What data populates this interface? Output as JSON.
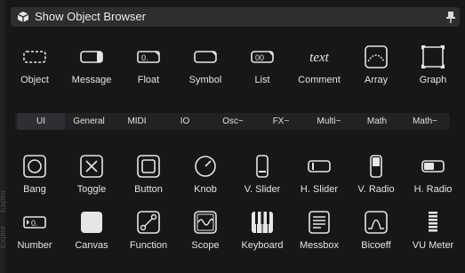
{
  "sidebar": {
    "label_top": "Explor",
    "label_bottom": "Explor"
  },
  "header": {
    "title": "Show Object Browser",
    "icon": "cube-icon",
    "pin_icon": "pin-icon"
  },
  "basic_objects": [
    {
      "label": "Object",
      "icon": "object-icon"
    },
    {
      "label": "Message",
      "icon": "message-icon"
    },
    {
      "label": "Float",
      "icon": "float-icon"
    },
    {
      "label": "Symbol",
      "icon": "symbol-icon"
    },
    {
      "label": "List",
      "icon": "list-icon"
    },
    {
      "label": "Comment",
      "icon": "comment-icon",
      "glyph": "text"
    },
    {
      "label": "Array",
      "icon": "array-icon"
    },
    {
      "label": "Graph",
      "icon": "graph-icon"
    }
  ],
  "tabs": {
    "active": "UI",
    "items": [
      "UI",
      "General",
      "MIDI",
      "IO",
      "Osc~",
      "FX~",
      "Multi~",
      "Math",
      "Math~"
    ]
  },
  "ui_objects_row1": [
    {
      "label": "Bang",
      "icon": "bang-icon"
    },
    {
      "label": "Toggle",
      "icon": "toggle-icon"
    },
    {
      "label": "Button",
      "icon": "button-icon"
    },
    {
      "label": "Knob",
      "icon": "knob-icon"
    },
    {
      "label": "V. Slider",
      "icon": "vslider-icon"
    },
    {
      "label": "H. Slider",
      "icon": "hslider-icon"
    },
    {
      "label": "V. Radio",
      "icon": "vradio-icon"
    },
    {
      "label": "H. Radio",
      "icon": "hradio-icon"
    }
  ],
  "ui_objects_row2": [
    {
      "label": "Number",
      "icon": "number-icon"
    },
    {
      "label": "Canvas",
      "icon": "canvas-icon"
    },
    {
      "label": "Function",
      "icon": "function-icon"
    },
    {
      "label": "Scope",
      "icon": "scope-icon"
    },
    {
      "label": "Keyboard",
      "icon": "keyboard-icon"
    },
    {
      "label": "Messbox",
      "icon": "messbox-icon"
    },
    {
      "label": "Bicoeff",
      "icon": "bicoeff-icon"
    },
    {
      "label": "VU Meter",
      "icon": "vumeter-icon"
    }
  ]
}
